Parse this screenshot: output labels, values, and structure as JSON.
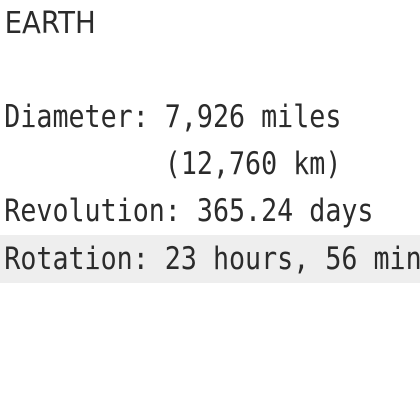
{
  "document": {
    "title": "EARTH",
    "lines": [
      "Diameter: 7,926 miles",
      "          (12,760 km)",
      "Revolution: 365.24 days",
      "Rotation: 23 hours, 56 min"
    ]
  },
  "colors": {
    "text": "#2b2b2b",
    "current_line_highlight": "#eeeeee",
    "background": "#ffffff"
  }
}
